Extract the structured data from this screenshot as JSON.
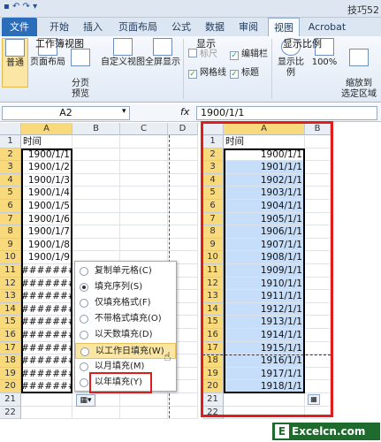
{
  "title_bar": {
    "app_title": "技巧52",
    "quick_access": "▪ ↶ ↷ ▾"
  },
  "tabs": [
    "文件",
    "开始",
    "插入",
    "页面布局",
    "公式",
    "数据",
    "审阅",
    "视图",
    "Acrobat"
  ],
  "ribbon": {
    "buttons": {
      "normal": "普通",
      "page_layout": "页面布局",
      "page_break": "分页\n预览",
      "custom_view": "自定义视图",
      "full_screen": "全屏显示",
      "zoom": "显示比例",
      "zoom100": "100%",
      "zoom_sel": "缩放到\n选定区域"
    },
    "checks": {
      "ruler": "标尺",
      "formula_bar": "编辑栏",
      "gridlines": "网格线",
      "headings": "标题"
    },
    "groups": {
      "views": "工作簿视图",
      "show": "显示",
      "zoom": "显示比例"
    }
  },
  "formula_bar": {
    "name_box": "A2",
    "fx": "fx",
    "value": "1900/1/1"
  },
  "left_sheet": {
    "col_headers": [
      "A",
      "B",
      "C",
      "D"
    ],
    "header_cell": "时间",
    "values": [
      "1900/1/1",
      "1900/1/2",
      "1900/1/3",
      "1900/1/4",
      "1900/1/5",
      "1900/1/6",
      "1900/1/7",
      "1900/1/8",
      "1900/1/9",
      "########",
      "########",
      "########",
      "########",
      "########",
      "########",
      "########",
      "########",
      "########",
      "########"
    ]
  },
  "right_sheet": {
    "col_headers": [
      "A",
      "B"
    ],
    "header_cell": "时间",
    "values": [
      "1900/1/1",
      "1901/1/1",
      "1902/1/1",
      "1903/1/1",
      "1904/1/1",
      "1905/1/1",
      "1906/1/1",
      "1907/1/1",
      "1908/1/1",
      "1909/1/1",
      "1910/1/1",
      "1911/1/1",
      "1912/1/1",
      "1913/1/1",
      "1914/1/1",
      "1915/1/1",
      "1916/1/1",
      "1917/1/1",
      "1918/1/1"
    ]
  },
  "autofill_menu": [
    {
      "label": "复制单元格(C)",
      "selected": false
    },
    {
      "label": "填充序列(S)",
      "selected": true
    },
    {
      "label": "仅填充格式(F)",
      "selected": false
    },
    {
      "label": "不带格式填充(O)",
      "selected": false
    },
    {
      "label": "以天数填充(D)",
      "selected": false
    },
    {
      "label": "以工作日填充(W)",
      "selected": false
    },
    {
      "label": "以月填充(M)",
      "selected": false
    },
    {
      "label": "以年填充(Y)",
      "selected": false
    }
  ],
  "watermark": "Excelcn.com"
}
